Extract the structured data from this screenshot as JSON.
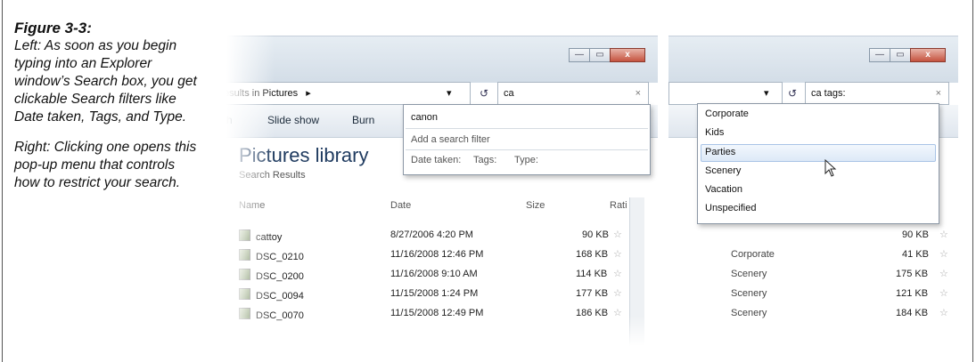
{
  "caption": {
    "title": "Figure 3-3:",
    "left_text": "Left: As soon as you begin typing into an Explorer window’s Search box, you get clickable Search filters like Date taken, Tags, and Type.",
    "right_text": "Right: Clicking one opens this pop-up menu that controls how to restrict your search."
  },
  "left_window": {
    "window_buttons": {
      "minimize": "—",
      "maximize": "▭",
      "close": "x"
    },
    "breadcrumb": "esults in Pictures",
    "breadcrumb_arrow": "▸",
    "dropdown_arrow": "▾",
    "refresh_glyph": "↺",
    "search_value": "ca",
    "search_clear": "×",
    "toolbar": [
      "ch",
      "Slide show",
      "Burn"
    ],
    "library_title": "Pictures library",
    "library_subtitle": "Search Results",
    "columns": [
      "Name",
      "Date",
      "Size",
      "Rati"
    ],
    "rows": [
      {
        "name": "cattoy",
        "date": "8/27/2006 4:20 PM",
        "size": "90 KB"
      },
      {
        "name": "DSC_0210",
        "date": "11/16/2008 12:46 PM",
        "size": "168 KB"
      },
      {
        "name": "DSC_0200",
        "date": "11/16/2008 9:10 AM",
        "size": "114 KB"
      },
      {
        "name": "DSC_0094",
        "date": "11/15/2008 1:24 PM",
        "size": "177 KB"
      },
      {
        "name": "DSC_0070",
        "date": "11/15/2008 12:49 PM",
        "size": "186 KB"
      }
    ],
    "star_glyph": "☆",
    "popup": {
      "suggestion": "canon",
      "filter_heading": "Add a search filter",
      "filters": [
        "Date taken:",
        "Tags:",
        "Type:"
      ]
    }
  },
  "right_window": {
    "window_buttons": {
      "minimize": "—",
      "maximize": "▭",
      "close": "x"
    },
    "dropdown_arrow": "▾",
    "refresh_glyph": "↺",
    "search_value": "ca tags:",
    "search_clear": "×",
    "menu_items": [
      "Corporate",
      "Kids",
      "Parties",
      "Scenery",
      "Vacation",
      "Unspecified"
    ],
    "highlighted_index": 2,
    "rows": [
      {
        "tags": "",
        "size": "90 KB"
      },
      {
        "tags": "Corporate",
        "size": "41 KB"
      },
      {
        "tags": "Scenery",
        "size": "175 KB"
      },
      {
        "tags": "Scenery",
        "size": "121 KB"
      },
      {
        "tags": "Scenery",
        "size": "184 KB"
      }
    ],
    "star_glyph": "☆"
  }
}
